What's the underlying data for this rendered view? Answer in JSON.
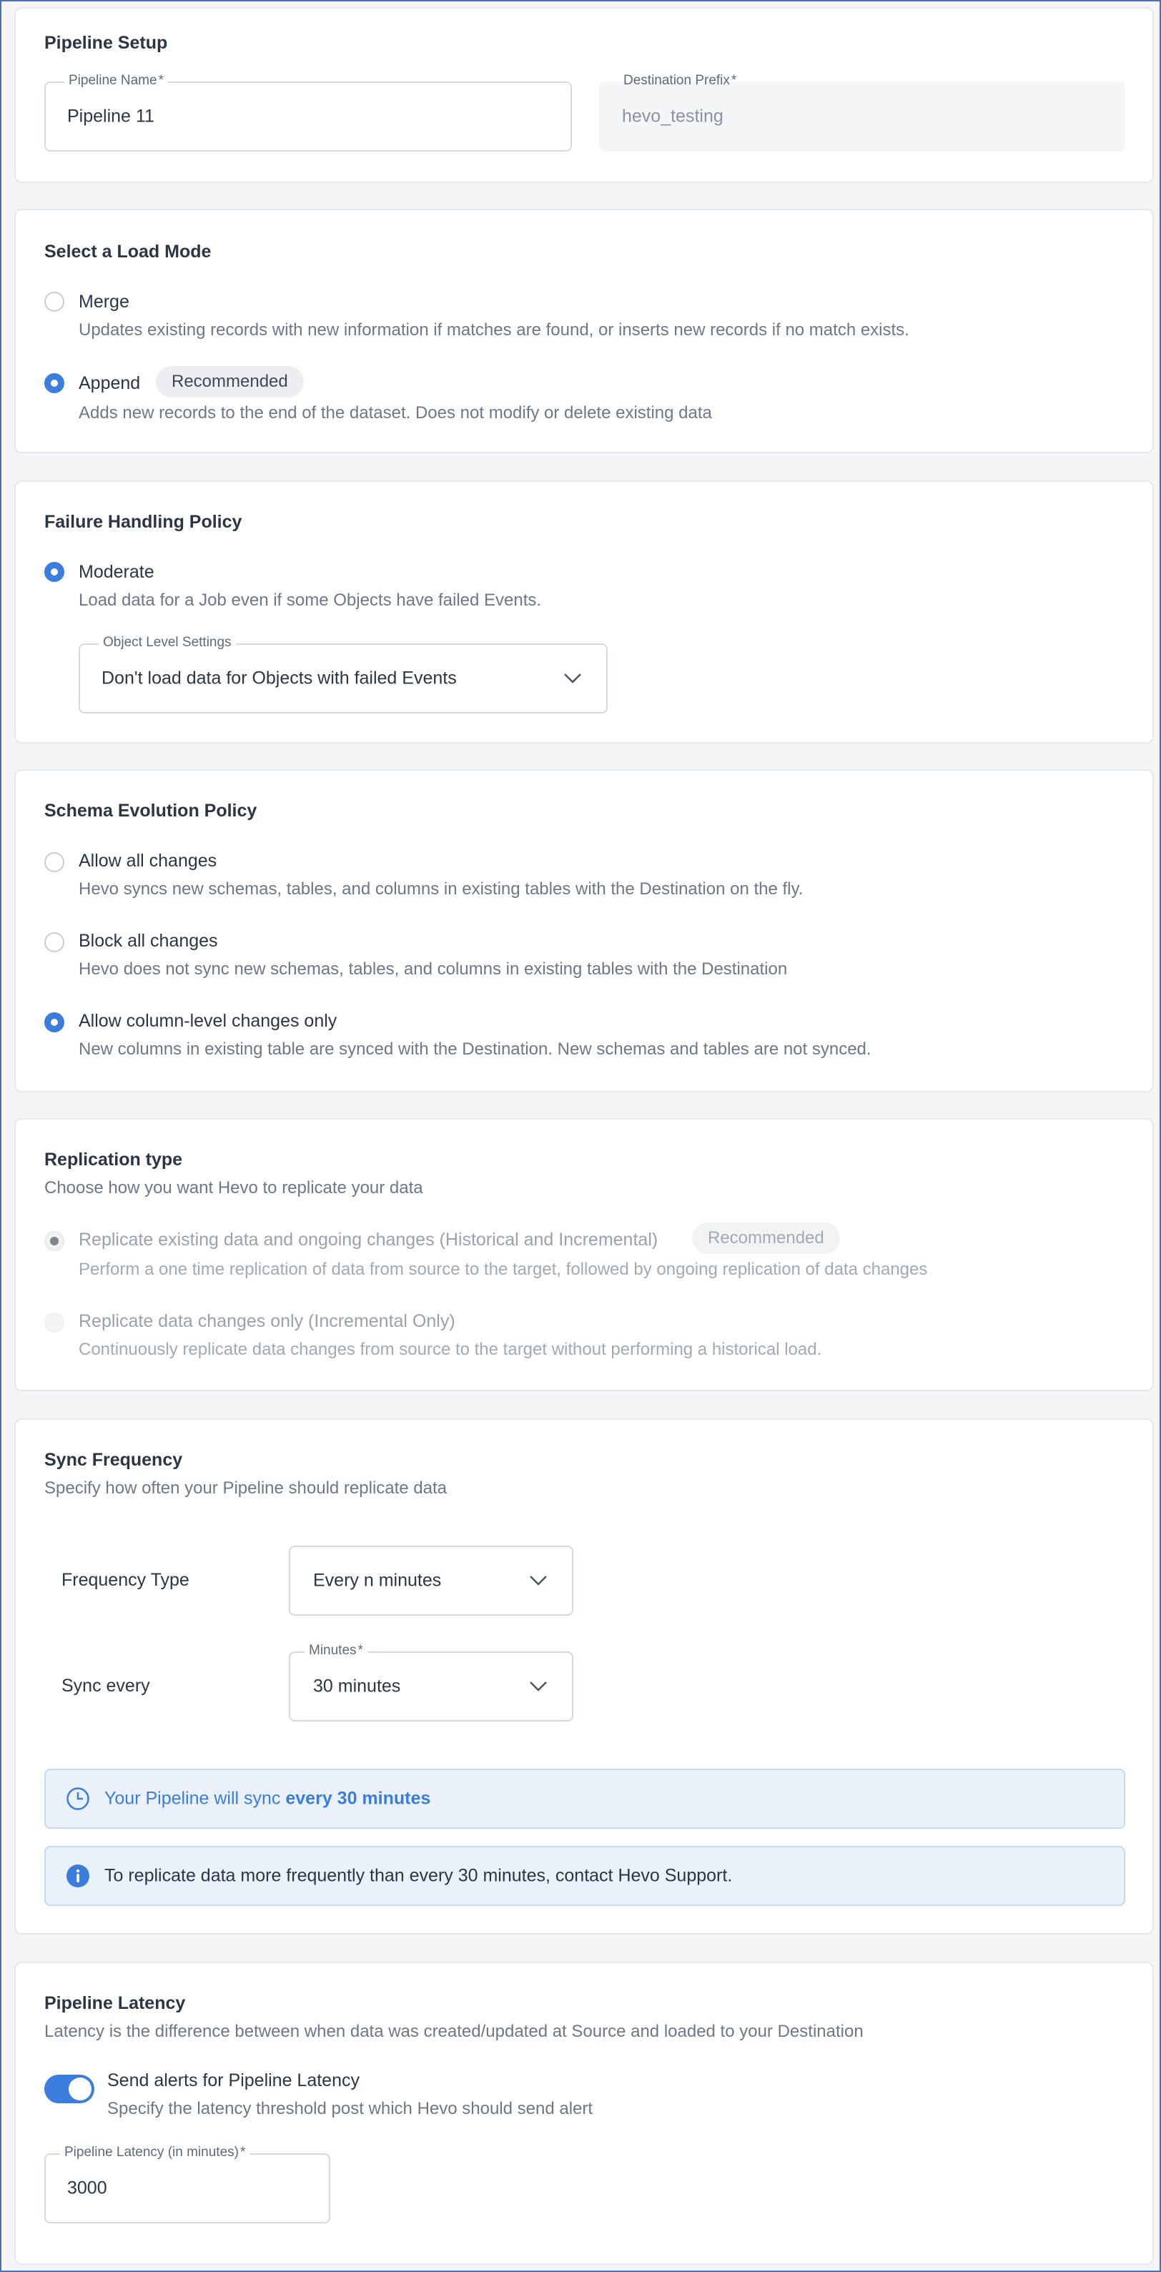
{
  "pipeline_setup": {
    "title": "Pipeline Setup",
    "name_label": "Pipeline Name",
    "name_value": "Pipeline 11",
    "prefix_label": "Destination Prefix",
    "prefix_value": "hevo_testing",
    "required_mark": "*"
  },
  "load_mode": {
    "title": "Select a Load Mode",
    "options": [
      {
        "label": "Merge",
        "desc": "Updates existing records with new information if matches are found, or inserts new records if no match exists.",
        "selected": false
      },
      {
        "label": "Append",
        "badge": "Recommended",
        "desc": "Adds new records to the end of the dataset. Does not modify or delete existing data",
        "selected": true
      }
    ]
  },
  "failure_policy": {
    "title": "Failure Handling Policy",
    "option_label": "Moderate",
    "option_desc": "Load data for a Job even if some Objects have failed Events.",
    "object_settings_label": "Object Level Settings",
    "object_settings_value": "Don't load data for Objects with failed Events"
  },
  "schema_policy": {
    "title": "Schema Evolution Policy",
    "options": [
      {
        "label": "Allow all changes",
        "desc": "Hevo syncs new schemas, tables, and columns in existing tables with the Destination on the fly.",
        "selected": false
      },
      {
        "label": "Block all changes",
        "desc": "Hevo does not sync new schemas, tables, and columns in existing tables with the Destination",
        "selected": false
      },
      {
        "label": "Allow column-level changes only",
        "desc": "New columns in existing table are synced with the Destination. New schemas and tables are not synced.",
        "selected": true
      }
    ]
  },
  "replication": {
    "title": "Replication type",
    "subtitle": "Choose how you want Hevo to replicate your data",
    "options": [
      {
        "label": "Replicate existing data and ongoing changes (Historical and Incremental)",
        "badge": "Recommended",
        "desc": "Perform a one time replication of data from source to the target, followed by ongoing replication of data changes",
        "selected": true
      },
      {
        "label": "Replicate data changes only (Incremental Only)",
        "desc": "Continuously replicate data changes from source to the target without performing a historical load.",
        "selected": false
      }
    ]
  },
  "sync": {
    "title": "Sync Frequency",
    "subtitle": "Specify how often your Pipeline should replicate data",
    "frequency_type_label": "Frequency Type",
    "frequency_type_value": "Every n minutes",
    "sync_every_label": "Sync every",
    "minutes_label": "Minutes",
    "minutes_value": "30 minutes",
    "notice_prefix": "Your Pipeline will sync ",
    "notice_bold": "every 30 minutes",
    "info_text": "To replicate data more frequently than every 30 minutes, contact Hevo Support."
  },
  "latency": {
    "title": "Pipeline Latency",
    "subtitle": "Latency is the difference between when data was created/updated at Source and loaded to your Destination",
    "toggle_label": "Send alerts for Pipeline Latency",
    "toggle_desc": "Specify the latency threshold post which Hevo should send alert",
    "toggle_on": true,
    "field_label": "Pipeline Latency (in minutes)",
    "field_value": "3000"
  },
  "colors": {
    "accent": "#3b7ddd",
    "text": "#2b3544",
    "muted": "#6e7786",
    "info_bg": "#eaf1fb"
  }
}
